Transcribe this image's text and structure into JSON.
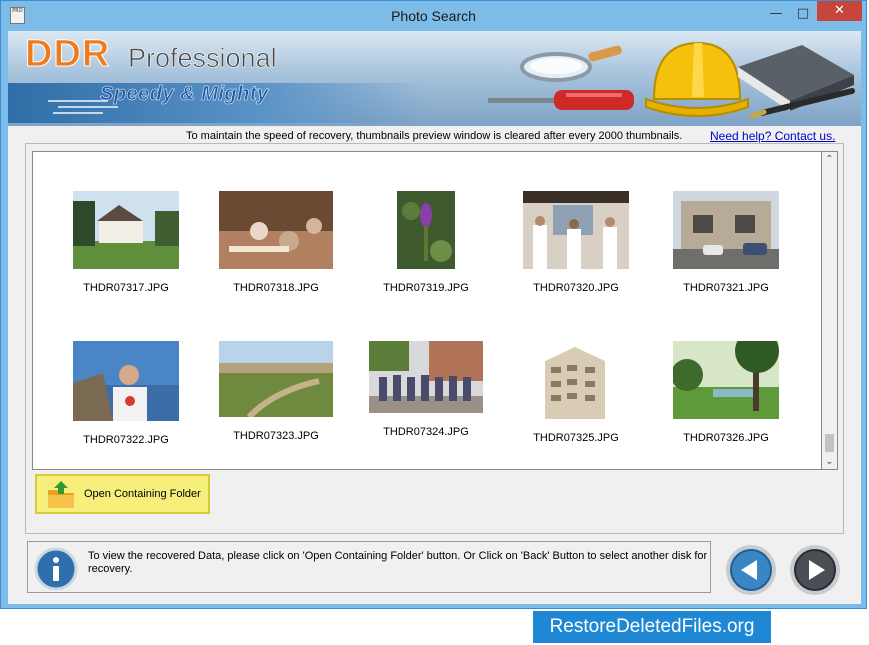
{
  "window": {
    "title": "Photo Search",
    "icon_text": "PRO"
  },
  "banner": {
    "logo_ddr": "DDR",
    "logo_professional": "Professional",
    "slogan": "Speedy & Mighty",
    "icons": [
      "magnifier-icon",
      "screwdriver-icon",
      "hard-hat-icon",
      "book-icon",
      "pen-icon"
    ]
  },
  "notice": "To maintain the speed of recovery, thumbnails preview window is cleared after every 2000 thumbnails.",
  "help_link": "Need help? Contact us.",
  "thumbnails": [
    {
      "name": "THDR07317.JPG",
      "scene": "house-lawn"
    },
    {
      "name": "THDR07318.JPG",
      "scene": "dinner-party"
    },
    {
      "name": "THDR07319.JPG",
      "scene": "purple-flower"
    },
    {
      "name": "THDR07320.JPG",
      "scene": "exhibition-people"
    },
    {
      "name": "THDR07321.JPG",
      "scene": "street-cafe"
    },
    {
      "name": "THDR07322.JPG",
      "scene": "man-by-sea"
    },
    {
      "name": "THDR07323.JPG",
      "scene": "castle-path"
    },
    {
      "name": "THDR07324.JPG",
      "scene": "group-photo"
    },
    {
      "name": "THDR07325.JPG",
      "scene": "apartment-building"
    },
    {
      "name": "THDR07326.JPG",
      "scene": "garden-pond"
    }
  ],
  "open_folder_button": "Open Containing Folder",
  "info_message": "To view the recovered Data, please click on 'Open Containing Folder' button. Or Click on 'Back' Button to select another disk for recovery.",
  "footer_brand": "RestoreDeletedFiles.org",
  "colors": {
    "title_bar": "#7dbbe8",
    "close_button": "#c7463c",
    "logo_orange": "#f07b1c",
    "slogan_blue": "#1e5aa8",
    "open_button": "#f6ef7c",
    "brand_banner": "#1e88d4"
  }
}
